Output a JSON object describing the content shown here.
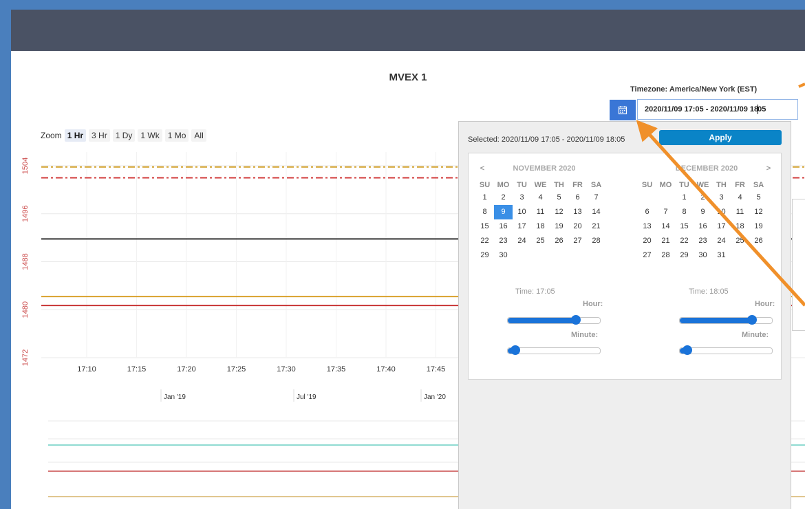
{
  "page": {
    "title": "MVEX 1",
    "timezone": "Timezone: America/New York (EST)"
  },
  "date_range": {
    "before": "2020/11/09 17:05 - 2020/11/09 18",
    "after": "05"
  },
  "zoom": {
    "label": "Zoom",
    "options": [
      "1 Hr",
      "3 Hr",
      "1 Dy",
      "1 Wk",
      "1 Mo",
      "All"
    ],
    "active": "1 Hr"
  },
  "chart_data": {
    "type": "line",
    "y_ticks": [
      "1504",
      "1496",
      "1488",
      "1480",
      "1472"
    ],
    "ylim": [
      1472,
      1504
    ],
    "x_ticks": [
      "17:10",
      "17:15",
      "17:20",
      "17:25",
      "17:30",
      "17:35",
      "17:40",
      "17:45"
    ],
    "series": [
      {
        "style": "dash-dot",
        "color": "#d4a12a",
        "values": [
          1503.8
        ]
      },
      {
        "style": "dash-dot",
        "color": "#d23c3c",
        "values": [
          1502.0
        ]
      },
      {
        "style": "solid",
        "color": "#333333",
        "values": [
          1491.8
        ]
      },
      {
        "style": "solid",
        "color": "#d9a12c",
        "values": [
          1482.2
        ]
      },
      {
        "style": "solid",
        "color": "#c83434",
        "values": [
          1480.7
        ]
      }
    ],
    "navigator_labels": [
      "Jan '19",
      "Jul '19",
      "Jan '20"
    ],
    "navigator_series_colors": [
      "#6ccfc4",
      "#c94a4a",
      "#d6b46a"
    ]
  },
  "popup": {
    "selected": "Selected: 2020/11/09 17:05 - 2020/11/09 18:05",
    "apply_label": "Apply",
    "prev_arrow": "<",
    "next_arrow": ">",
    "dow": [
      "SU",
      "MO",
      "TU",
      "WE",
      "TH",
      "FR",
      "SA"
    ],
    "left": {
      "name": "NOVEMBER 2020",
      "time": "Time: 17:05",
      "hour_label": "Hour:",
      "minute_label": "Minute:",
      "hour_fraction": 0.74,
      "minute_fraction": 0.08,
      "weeks": [
        [
          "1",
          "2",
          "3",
          "4",
          "5",
          "6",
          "7"
        ],
        [
          "8",
          "9",
          "10",
          "11",
          "12",
          "13",
          "14"
        ],
        [
          "15",
          "16",
          "17",
          "18",
          "19",
          "20",
          "21"
        ],
        [
          "22",
          "23",
          "24",
          "25",
          "26",
          "27",
          "28"
        ],
        [
          "29",
          "30",
          "",
          "",
          "",
          "",
          ""
        ]
      ],
      "selected_day": "9"
    },
    "right": {
      "name": "DECEMBER 2020",
      "time": "Time: 18:05",
      "hour_label": "Hour:",
      "minute_label": "Minute:",
      "hour_fraction": 0.78,
      "minute_fraction": 0.08,
      "weeks": [
        [
          "",
          "",
          "1",
          "2",
          "3",
          "4",
          "5"
        ],
        [
          "6",
          "7",
          "8",
          "9",
          "10",
          "11",
          "12"
        ],
        [
          "13",
          "14",
          "15",
          "16",
          "17",
          "18",
          "19"
        ],
        [
          "20",
          "21",
          "22",
          "23",
          "24",
          "25",
          "26"
        ],
        [
          "27",
          "28",
          "29",
          "30",
          "31",
          "",
          ""
        ]
      ]
    }
  },
  "colors": {
    "accent": "#3a76d6",
    "topbar": "#4a5264",
    "apply": "#0a84c7",
    "annotation": "#f0902a"
  }
}
